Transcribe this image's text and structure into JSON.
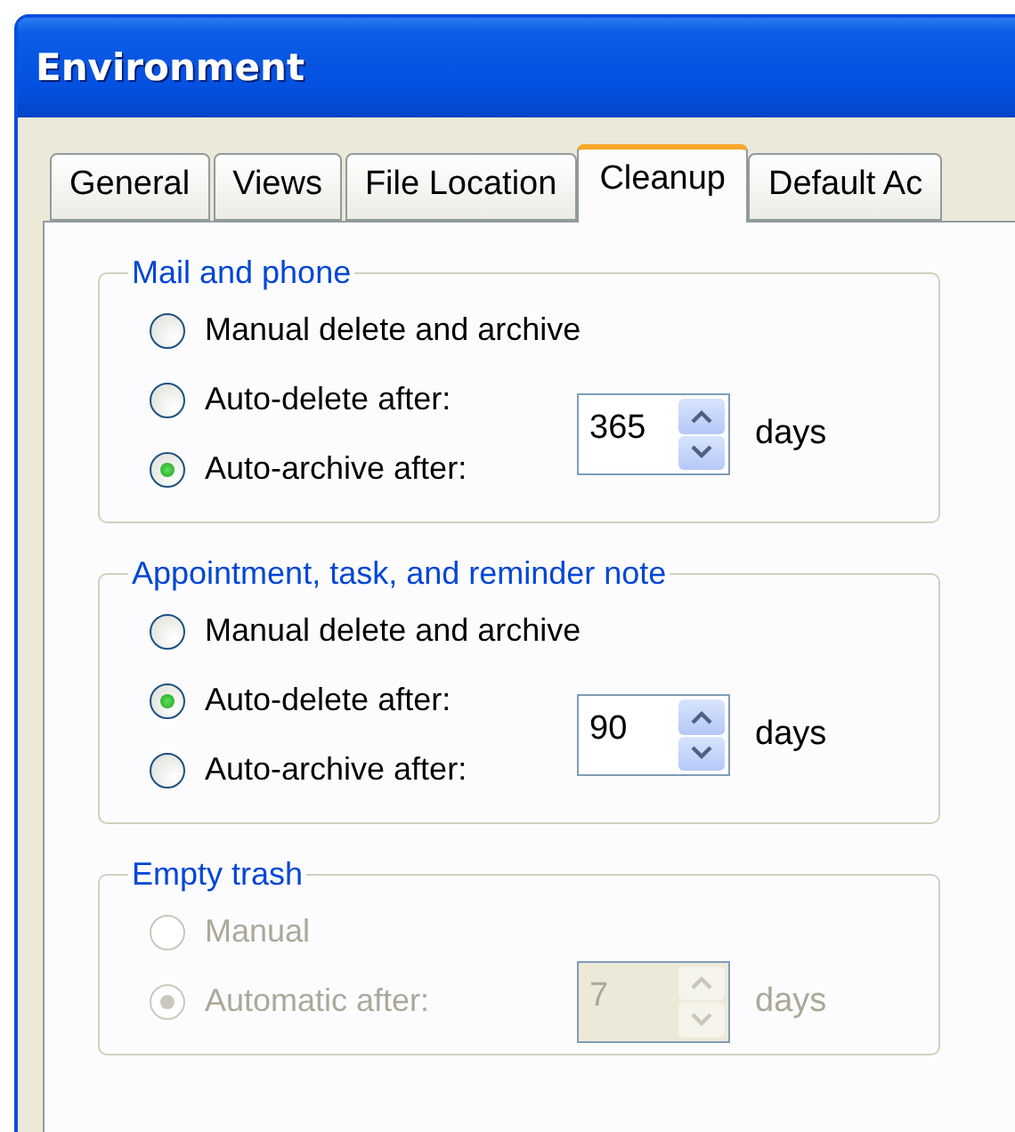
{
  "window": {
    "title": "Environment"
  },
  "tabs": [
    {
      "label": "General",
      "selected": false
    },
    {
      "label": "Views",
      "selected": false
    },
    {
      "label": "File Location",
      "selected": false
    },
    {
      "label": "Cleanup",
      "selected": true
    },
    {
      "label": "Default Ac",
      "selected": false
    }
  ],
  "groups": [
    {
      "title": "Mail and phone",
      "disabled": false,
      "options": [
        {
          "label": "Manual delete and archive",
          "selected": false
        },
        {
          "label": "Auto-delete after:",
          "selected": false
        },
        {
          "label": "Auto-archive after:",
          "selected": true
        }
      ],
      "spin": {
        "value": "365",
        "unit": "days"
      }
    },
    {
      "title": "Appointment, task, and reminder note",
      "disabled": false,
      "options": [
        {
          "label": "Manual delete and archive",
          "selected": false
        },
        {
          "label": "Auto-delete after:",
          "selected": true
        },
        {
          "label": "Auto-archive after:",
          "selected": false
        }
      ],
      "spin": {
        "value": "90",
        "unit": "days"
      }
    },
    {
      "title": "Empty trash",
      "disabled": true,
      "options": [
        {
          "label": "Manual",
          "selected": false
        },
        {
          "label": "Automatic after:",
          "selected": true
        }
      ],
      "spin": {
        "value": "7",
        "unit": "days"
      }
    }
  ]
}
